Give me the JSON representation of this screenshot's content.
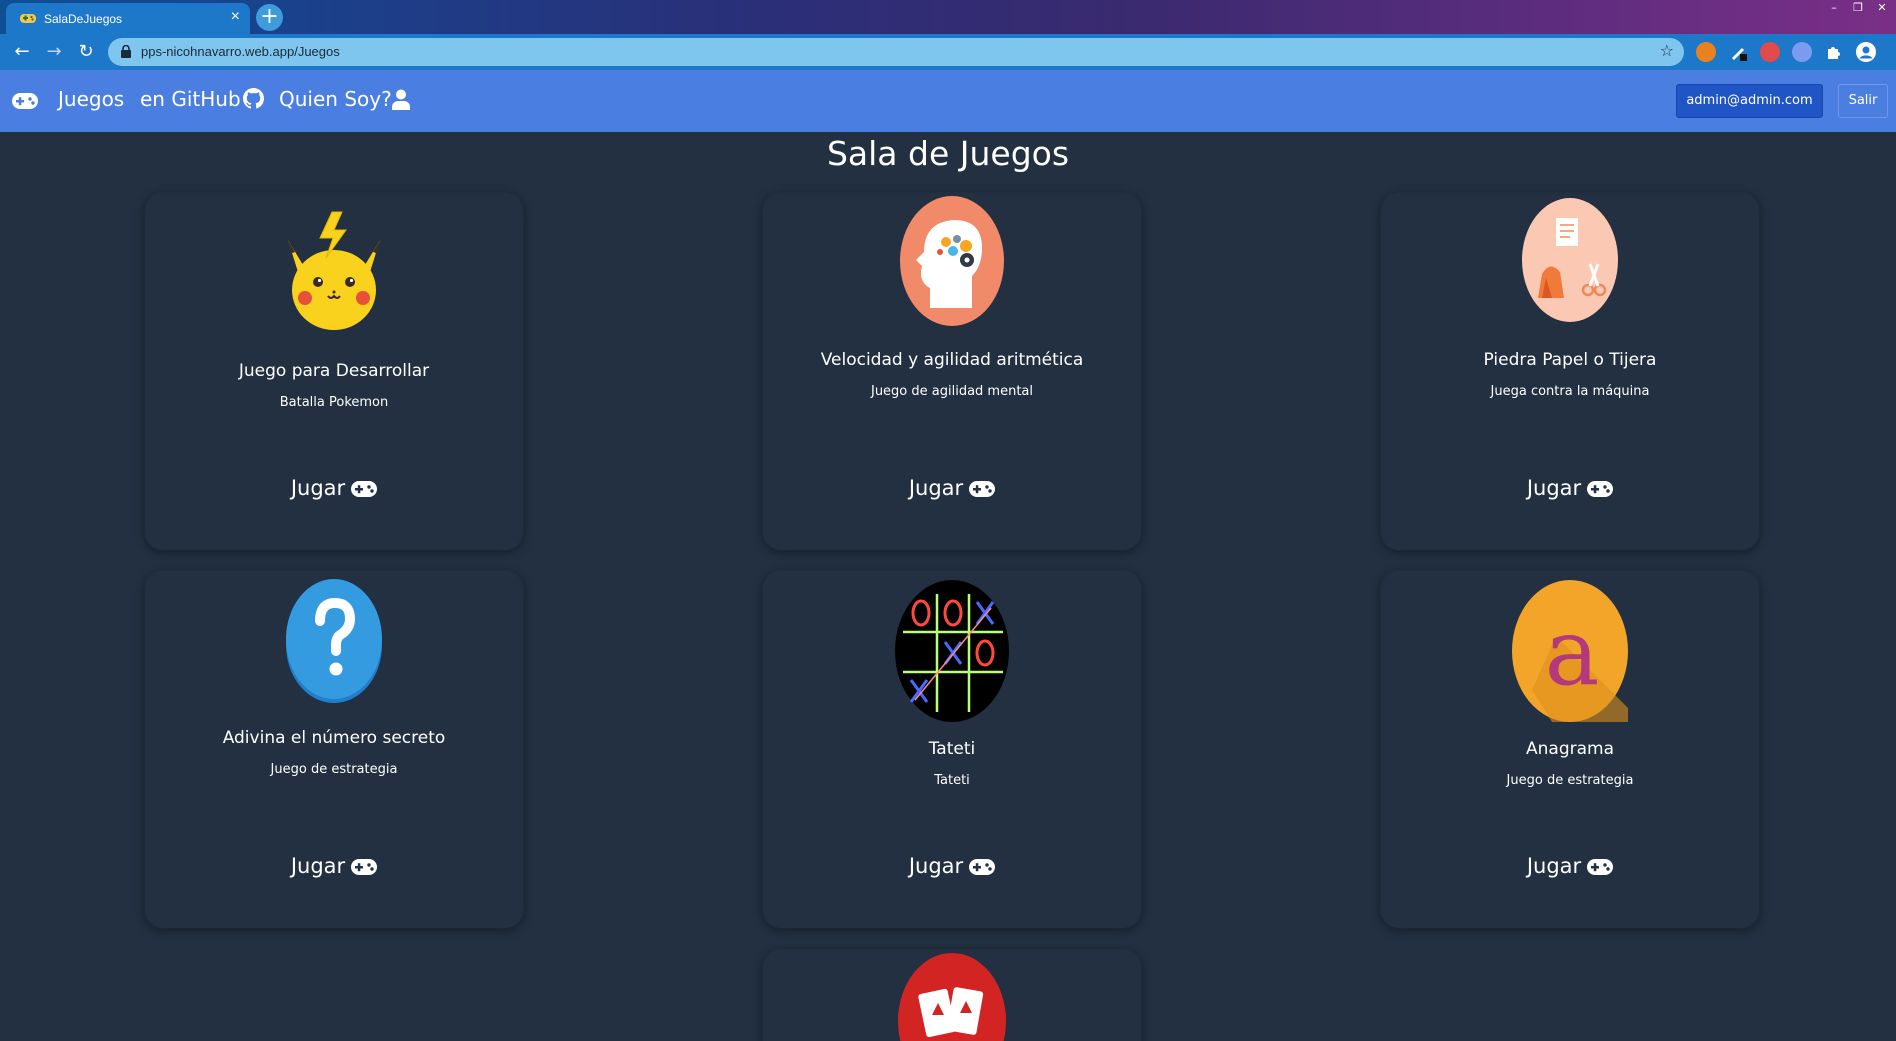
{
  "browser": {
    "tab_title": "SalaDeJuegos",
    "tab_close": "×",
    "new_tab": "+",
    "url": "pps-nicohnavarro.web.app/Juegos",
    "window_controls": [
      "–",
      "❐",
      "✕"
    ],
    "nav": {
      "back": "←",
      "forward": "→",
      "reload": "↻",
      "star": "☆"
    }
  },
  "navbar": {
    "links": [
      {
        "label": "Juegos",
        "icon": "gamepad-icon"
      },
      {
        "label": "en GitHub",
        "icon": "github-icon"
      },
      {
        "label": "Quien Soy?",
        "icon": "user-icon"
      }
    ],
    "user_email": "admin@admin.com",
    "logout": "Salir"
  },
  "page": {
    "title": "Sala de Juegos"
  },
  "play_label": "Jugar",
  "games": [
    {
      "title": "Juego para Desarrollar",
      "subtitle": "Batalla Pokemon",
      "icon": "pikachu-icon"
    },
    {
      "title": "Velocidad y agilidad aritmética",
      "subtitle": "Juego de agilidad mental",
      "icon": "brain-gears-icon"
    },
    {
      "title": "Piedra Papel o Tijera",
      "subtitle": "Juega contra la máquina",
      "icon": "rock-paper-scissors-icon"
    },
    {
      "title": "Adivina el número secreto",
      "subtitle": "Juego de estrategia",
      "icon": "question-mark-icon"
    },
    {
      "title": "Tateti",
      "subtitle": "Tateti",
      "icon": "tic-tac-toe-icon"
    },
    {
      "title": "Anagrama",
      "subtitle": "Juego de estrategia",
      "icon": "letter-a-icon"
    },
    {
      "title": "",
      "subtitle": "",
      "icon": "cards-icon"
    }
  ],
  "colors": {
    "background": "#223041",
    "navbar": "#4a7ee0",
    "user_button": "#2055c5"
  }
}
